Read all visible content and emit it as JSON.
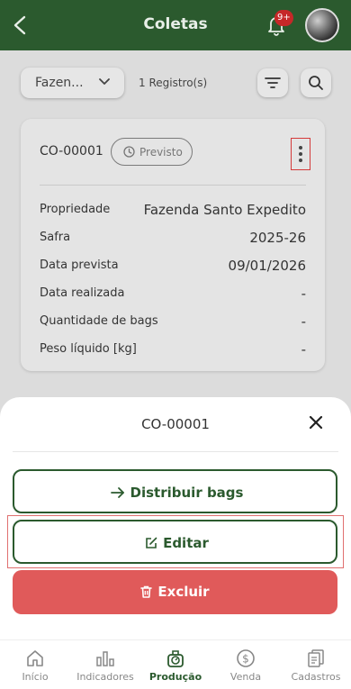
{
  "header": {
    "title": "Coletas",
    "notifications": "9+"
  },
  "toolbar": {
    "filter_value": "Fazen...",
    "records": "1 Registro(s)"
  },
  "card": {
    "code": "CO-00001",
    "status": "Previsto",
    "fields": [
      {
        "label": "Propriedade",
        "value": "Fazenda Santo Expedito"
      },
      {
        "label": "Safra",
        "value": "2025-26"
      },
      {
        "label": "Data prevista",
        "value": "09/01/2026"
      },
      {
        "label": "Data realizada",
        "value": "-"
      },
      {
        "label": "Quantidade de bags",
        "value": "-"
      },
      {
        "label": "Peso líquido [kg]",
        "value": "-"
      }
    ]
  },
  "sheet": {
    "title": "CO-00001",
    "distribute_label": "Distribuir bags",
    "edit_label": "Editar",
    "delete_label": "Excluir"
  },
  "nav": {
    "items": [
      {
        "label": "Início",
        "icon": "home-icon"
      },
      {
        "label": "Indicadores",
        "icon": "bar-chart-icon"
      },
      {
        "label": "Produção",
        "icon": "scale-icon",
        "active": true
      },
      {
        "label": "Venda",
        "icon": "dollar-icon"
      },
      {
        "label": "Cadastros",
        "icon": "documents-icon"
      }
    ]
  },
  "colors": {
    "primary": "#2b5a2e",
    "danger": "#e05a5a",
    "badge": "#c62828",
    "highlight": "#d43a3a"
  }
}
